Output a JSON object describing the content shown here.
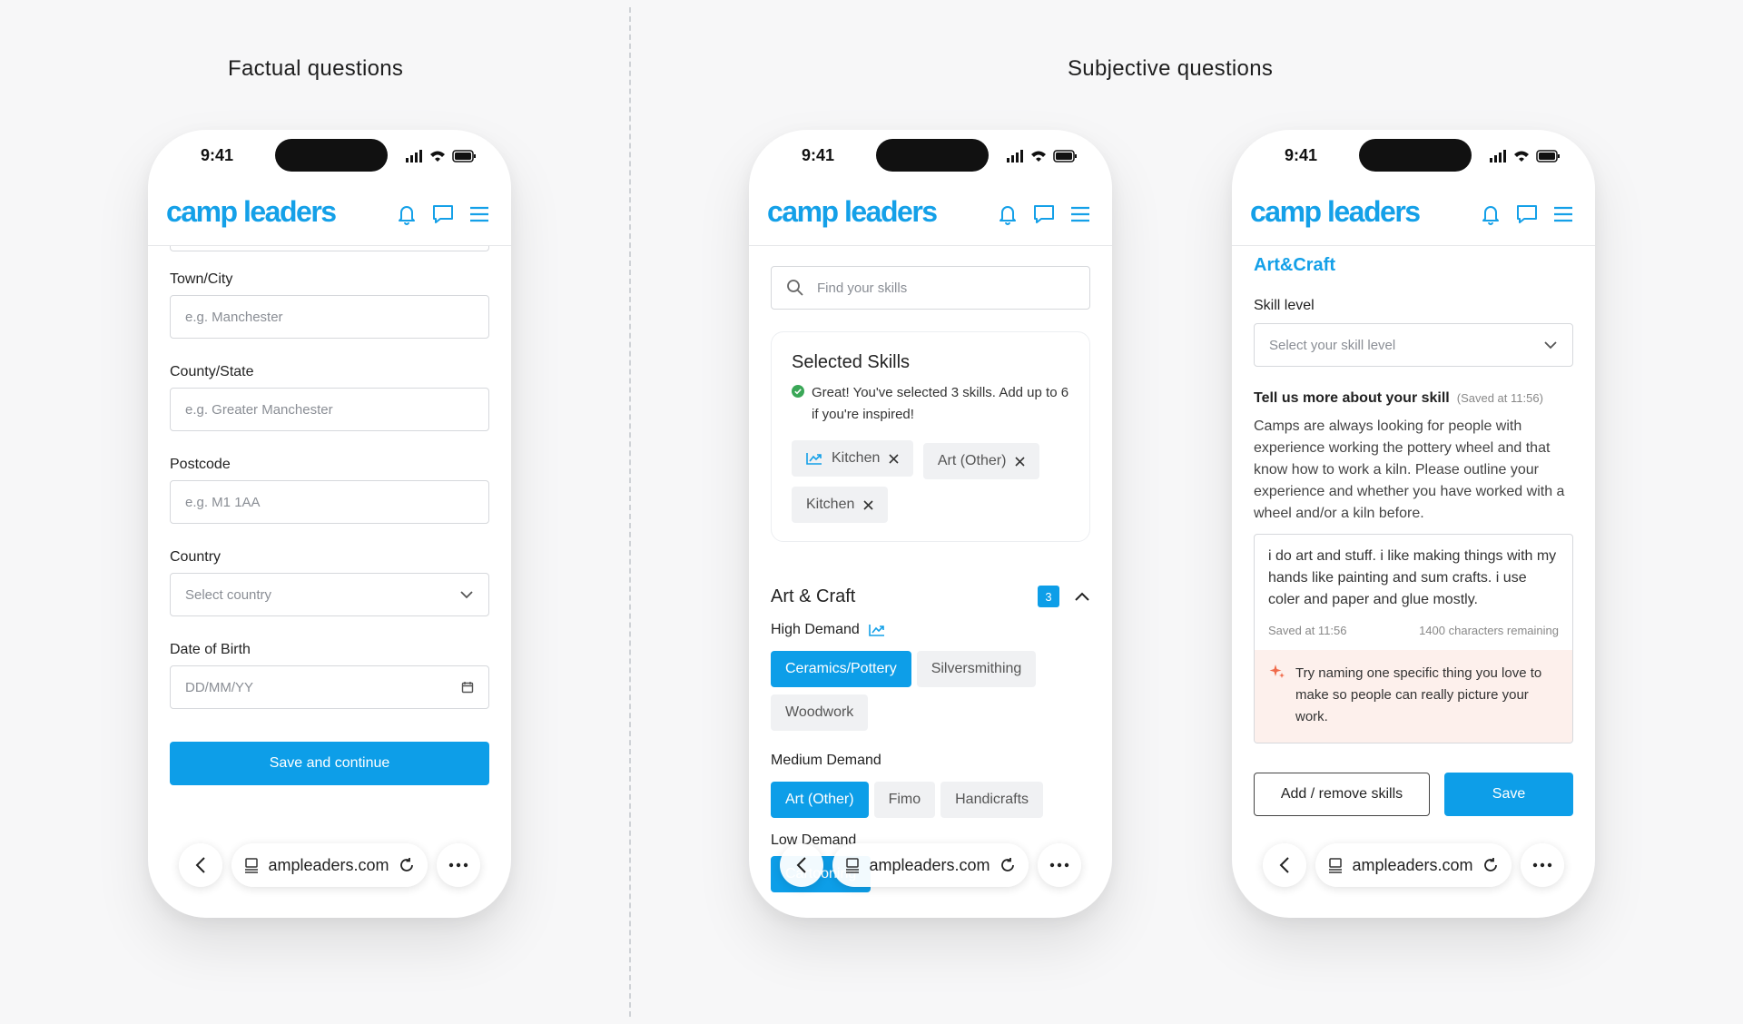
{
  "sections": {
    "left_title": "Factual questions",
    "right_title": "Subjective questions"
  },
  "common": {
    "time": "9:41",
    "logo_a": "camp",
    "logo_b": "leaders",
    "url": "ampleaders.com"
  },
  "phone1": {
    "fields": [
      {
        "label": "Town/City",
        "placeholder": "e.g. Manchester"
      },
      {
        "label": "County/State",
        "placeholder": "e.g. Greater Manchester"
      },
      {
        "label": "Postcode",
        "placeholder": "e.g. M1 1AA"
      },
      {
        "label": "Country",
        "placeholder": "Select country"
      },
      {
        "label": "Date of Birth",
        "placeholder": "DD/MM/YY"
      }
    ],
    "save_label": "Save and continue"
  },
  "phone2": {
    "search_placeholder": "Find your skills",
    "selected_title": "Selected Skills",
    "selected_msg": "Great! You've selected 3 skills. Add up to 6 if you're inspired!",
    "selected_chips": [
      "Kitchen",
      "Art (Other)",
      "Kitchen"
    ],
    "category": "Art & Craft",
    "category_count": "3",
    "high_demand": "High Demand",
    "high_chips": [
      "Ceramics/Pottery",
      "Silversmithing",
      "Woodwork"
    ],
    "medium_demand": "Medium Demand",
    "medium_chips": [
      "Art (Other)",
      "Fimo",
      "Handicrafts"
    ],
    "low_demand": "Low Demand",
    "low_chips": [
      "Cartooning"
    ]
  },
  "phone3": {
    "title": "Art&Craft",
    "skill_level_label": "Skill level",
    "skill_level_placeholder": "Select your skill level",
    "tell_label": "Tell us more about your skill",
    "saved_note": "(Saved at 11:56)",
    "prompt": "Camps are always looking for people with experience working the pottery wheel and that know how to work a kiln. Please outline your experience and whether you have worked with a wheel and/or a kiln before.",
    "answer": "i do art and stuff. i like making things with my hands like painting and sum crafts. i use coler and paper and glue mostly.",
    "saved_at": "Saved at 11:56",
    "remaining": "1400 characters remaining",
    "tip": "Try naming one specific thing you love to make so people can really picture your work.",
    "add_remove_label": "Add / remove skills",
    "save_label": "Save"
  },
  "colors": {
    "brand": "#14a0e8",
    "primary": "#0d9ee8",
    "success": "#3aa757",
    "tip_bg": "#fdf0ec",
    "tip_icon": "#f06a4a"
  }
}
